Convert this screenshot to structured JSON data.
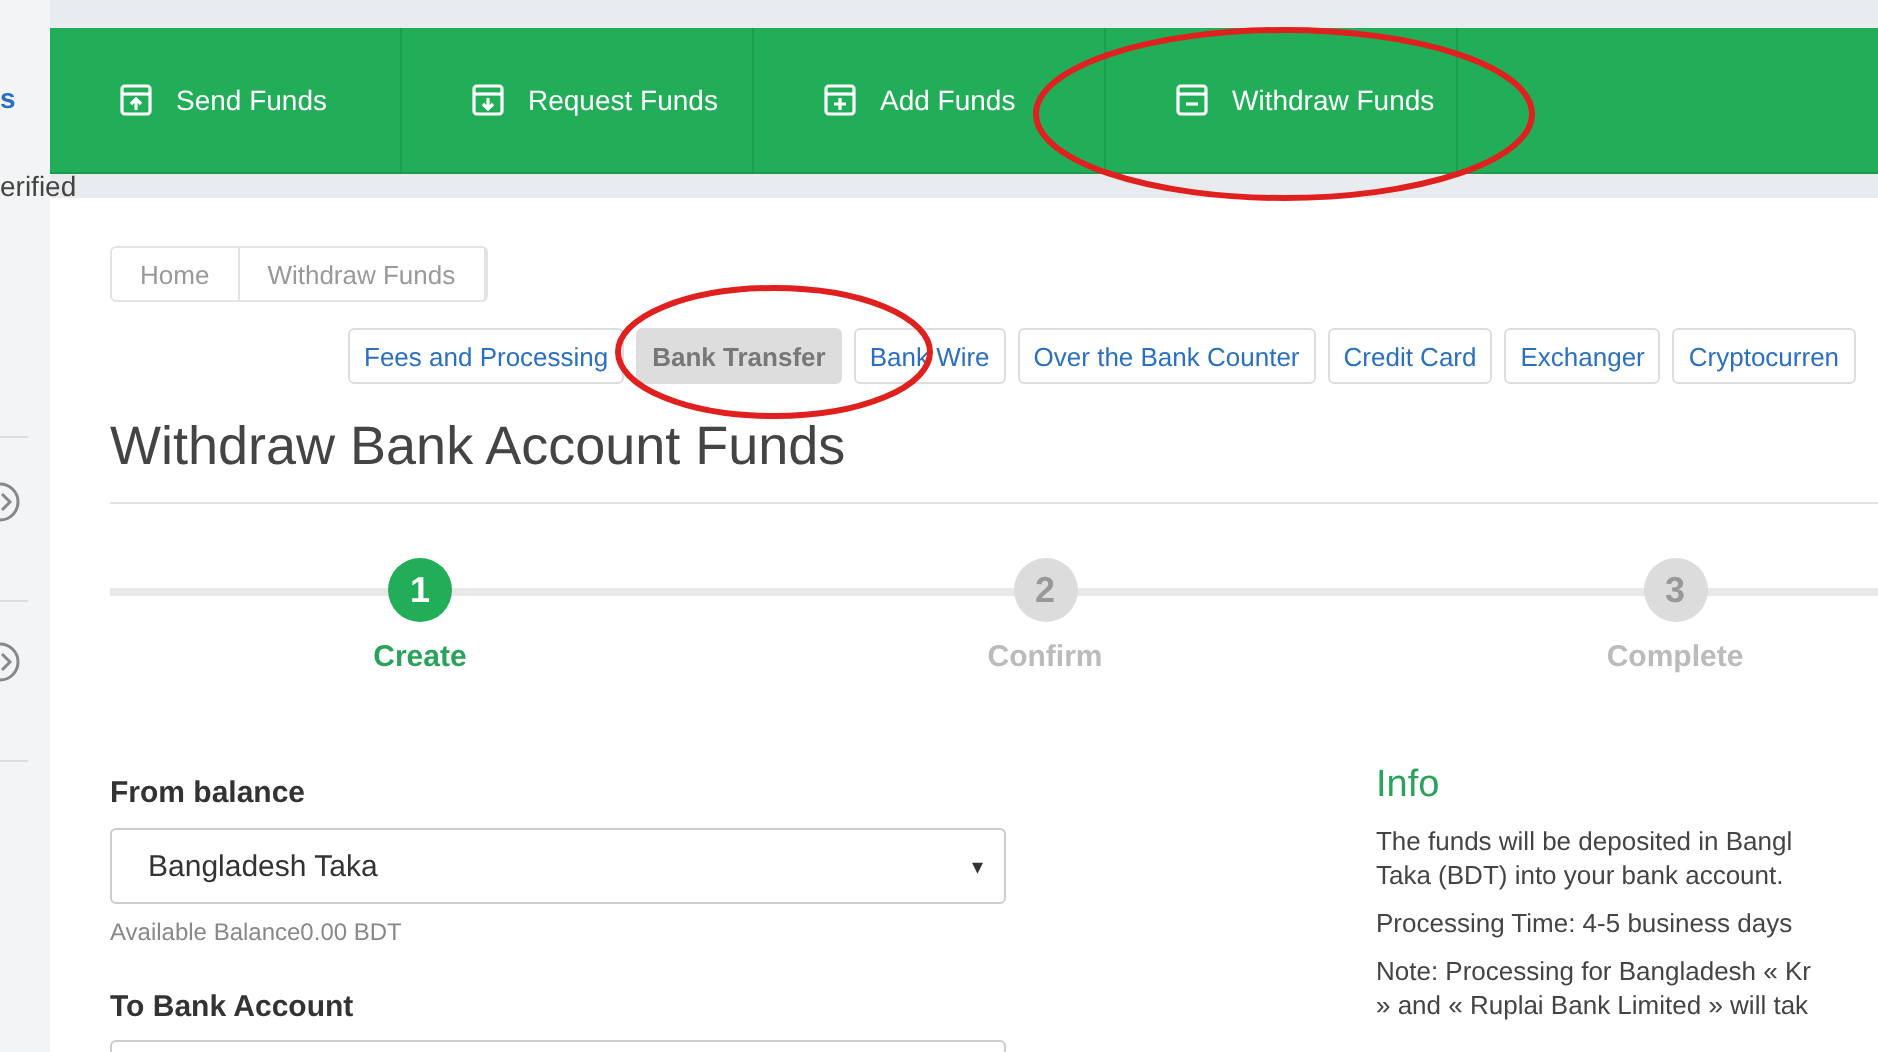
{
  "sidebar": {
    "link_fragment": "s",
    "status_fragment": "erified"
  },
  "nav": [
    {
      "label": "Send Funds",
      "circled": false
    },
    {
      "label": "Request Funds",
      "circled": false
    },
    {
      "label": "Add Funds",
      "circled": false
    },
    {
      "label": "Withdraw Funds",
      "circled": true
    }
  ],
  "breadcrumb": [
    "Home",
    "Withdraw Funds"
  ],
  "methods": [
    {
      "label": "Fees and Processing",
      "selected": false,
      "circled": false
    },
    {
      "label": "Bank Transfer",
      "selected": true,
      "circled": true
    },
    {
      "label": "Bank Wire",
      "selected": false,
      "circled": false
    },
    {
      "label": "Over the Bank Counter",
      "selected": false,
      "circled": false
    },
    {
      "label": "Credit Card",
      "selected": false,
      "circled": false
    },
    {
      "label": "Exchanger",
      "selected": false,
      "circled": false
    },
    {
      "label": "Cryptocurren",
      "selected": false,
      "circled": false
    }
  ],
  "title": "Withdraw Bank Account Funds",
  "steps": [
    {
      "number": "1",
      "label": "Create",
      "selected": true
    },
    {
      "number": "2",
      "label": "Confirm",
      "selected": false
    },
    {
      "number": "3",
      "label": "Complete",
      "selected": false
    }
  ],
  "form": {
    "from_label": "From balance",
    "from_value": "Bangladesh Taka",
    "caret": "▾",
    "help": "Available Balance0.00 BDT",
    "to_label": "To Bank Account"
  },
  "info": {
    "title": "Info",
    "paragraphs": [
      [
        "The funds will be deposited in Bangl",
        "Taka (BDT) into your bank account."
      ],
      [
        "Processing Time: 4-5 business days"
      ],
      [
        "Note: Processing for Bangladesh « Kr",
        "» and « Ruplai Bank Limited » will tak"
      ]
    ]
  }
}
